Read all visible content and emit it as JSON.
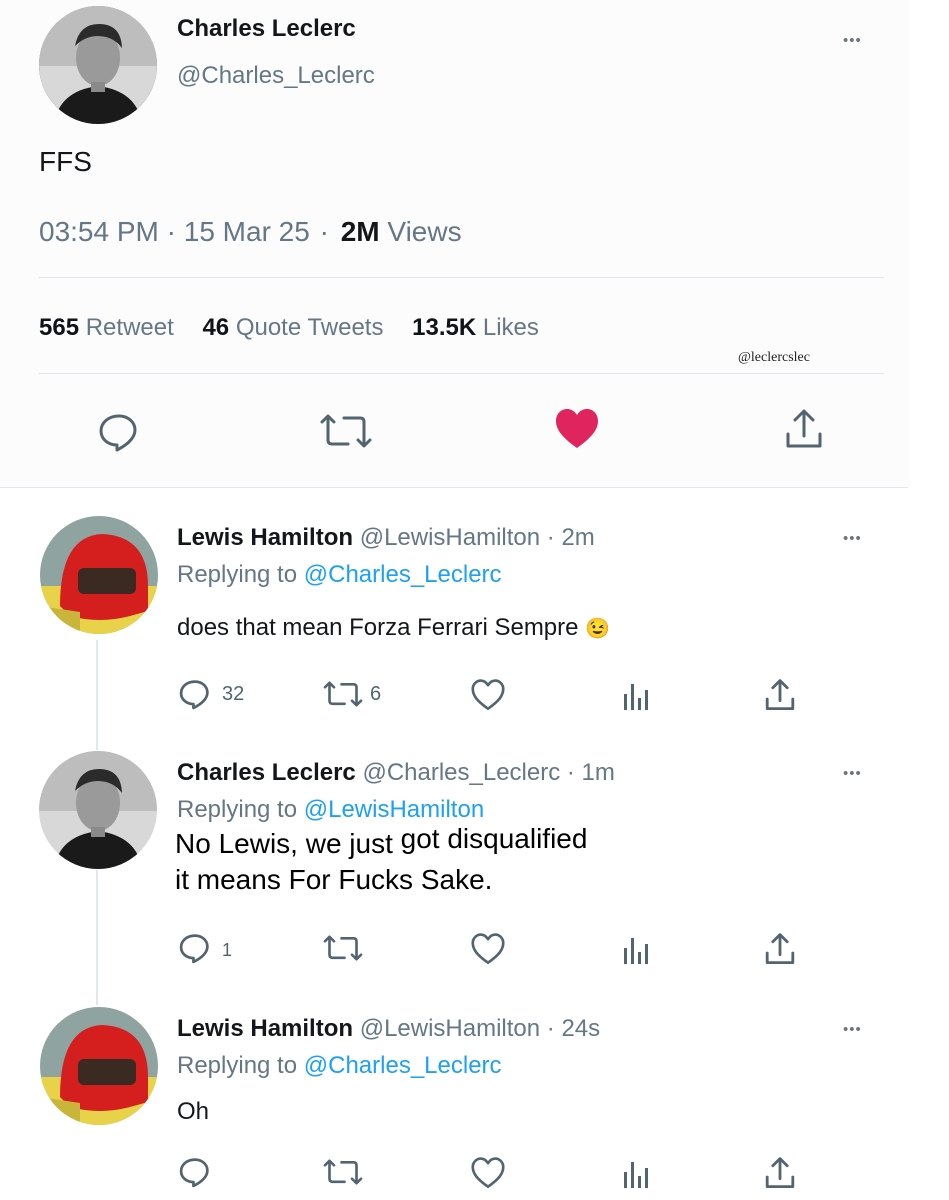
{
  "main_tweet": {
    "name": "Charles Leclerc",
    "handle": "@Charles_Leclerc",
    "text": "FFS",
    "time": "03:54 PM",
    "date": "15 Mar 25",
    "views_count": "2M",
    "views_label": "Views",
    "separator": "·",
    "retweet_count": "565",
    "retweet_label": "Retweet",
    "quote_count": "46",
    "quote_label": "Quote Tweets",
    "likes_count": "13.5K",
    "likes_label": "Likes",
    "watermark": "@leclercslec",
    "more": "•••"
  },
  "replies": [
    {
      "name": "Lewis Hamilton",
      "meta": "@LewisHamilton · 2m",
      "replying_prefix": "Replying to",
      "replying_to": "@Charles_Leclerc",
      "text": "does that mean Forza Ferrari Sempre",
      "emoji": "😉",
      "reply_count": "32",
      "retweet_count": "6",
      "more": "•••"
    },
    {
      "name": "Charles Leclerc",
      "meta": "@Charles_Leclerc · 1m",
      "replying_prefix": "Replying to",
      "replying_to": "@LewisHamilton",
      "text_line1a": "No Lewis, we just",
      "text_line1b": "got disqualified",
      "text_line2": "it means For Fucks Sake.",
      "reply_count": "1",
      "more": "•••"
    },
    {
      "name": "Lewis Hamilton",
      "meta": "@LewisHamilton · 24s",
      "replying_prefix": "Replying to",
      "replying_to": "@Charles_Leclerc",
      "text": "Oh",
      "more": "•••"
    }
  ],
  "colors": {
    "like_active": "#e0245e",
    "link": "#1da1f2",
    "secondary": "#657786",
    "icon": "#536471"
  }
}
